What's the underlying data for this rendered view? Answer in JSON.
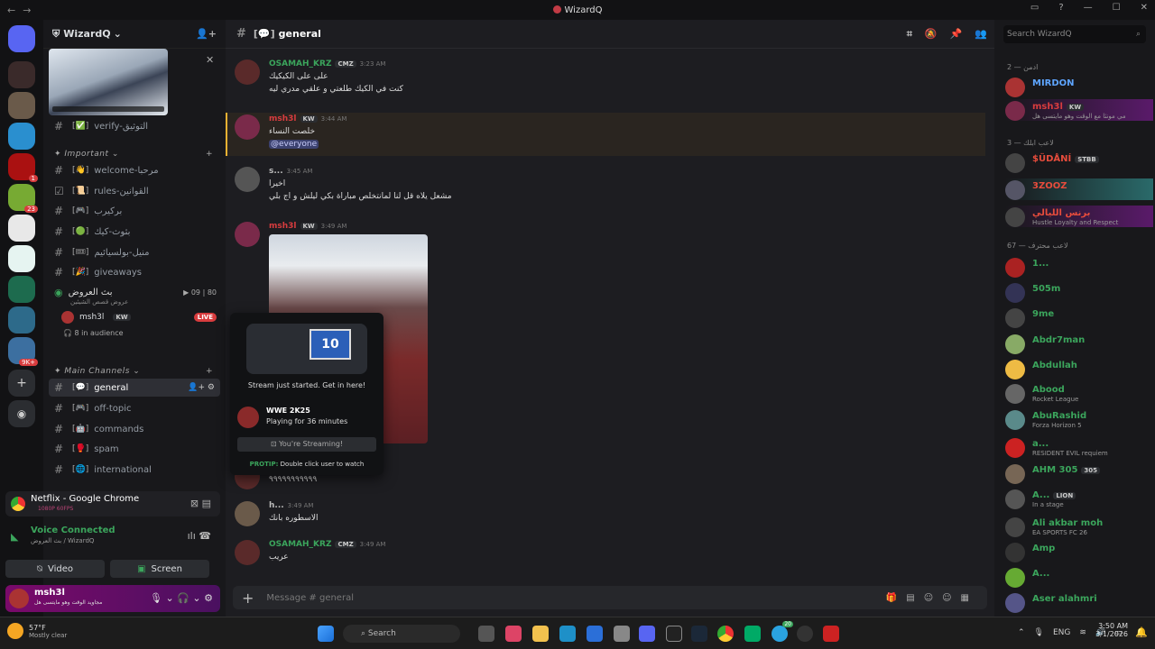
{
  "window": {
    "title": "WizardQ",
    "nav_back": "←",
    "nav_fwd": "→"
  },
  "guild": {
    "name": "WizardQ"
  },
  "channels": [
    {
      "name": "verify-التوثيق",
      "emoji": "✅",
      "kind": "text"
    },
    {
      "category": "Important"
    },
    {
      "name": "welcome-مرحبا",
      "emoji": "👋",
      "kind": "text"
    },
    {
      "name": "rules-القوانين",
      "emoji": "📜",
      "kind": "rules"
    },
    {
      "name": "بركيرب",
      "emoji": "🎮",
      "kind": "text"
    },
    {
      "name": "بثوث-كيك",
      "emoji": "🟢",
      "kind": "text"
    },
    {
      "name": "منيل-بولسيائيم",
      "emoji": "🎟",
      "kind": "text"
    },
    {
      "name": "giveaways",
      "emoji": "🎉",
      "kind": "text"
    },
    {
      "category": "Main Channels"
    },
    {
      "name": "general",
      "emoji": "💬",
      "kind": "text",
      "active": true
    },
    {
      "name": "off-topic",
      "emoji": "🎮",
      "kind": "text"
    },
    {
      "name": "commands",
      "emoji": "🤖",
      "kind": "text"
    },
    {
      "name": "spam",
      "emoji": "🥊",
      "kind": "text"
    },
    {
      "name": "international",
      "emoji": "🌐",
      "kind": "text"
    }
  ],
  "categories": {
    "important": "Important",
    "main": "Main Channels"
  },
  "voice": {
    "channel": "بث العروض",
    "sub": "عروض قصص الشيئين",
    "count1": "09",
    "count2": "80",
    "user": "msh3l",
    "user_tag": "KW",
    "live": "LIVE",
    "audience": "8 in audience"
  },
  "stream_card": {
    "title": "Netflix - Google Chrome",
    "quality": "1080P 60FPS"
  },
  "vc": {
    "status": "Voice Connected",
    "location": "بث العروض / WizardQ",
    "video": "Video",
    "screen": "Screen"
  },
  "me": {
    "name": "msh3l",
    "status": "مجاويد الوقت وهو مايتسى هل"
  },
  "chat": {
    "channel": "general",
    "messages": [
      {
        "author": "OSAMAH_KRZ",
        "tag": "CMZ",
        "time": "3:23 AM",
        "lines": [
          "على على الكيكيك",
          "كنت في الكيك طلعتي و علقي مدري ليه"
        ],
        "color": "#3ba55c"
      },
      {
        "author": "msh3l",
        "tag": "KW",
        "time": "3:44 AM",
        "lines": [
          "خلصت النساء"
        ],
        "mention": "@everyone",
        "color": "#d83c3e"
      },
      {
        "author": "s...",
        "tag": "",
        "time": "3:45 AM",
        "lines": [
          "اخيرا",
          "مشعل يلاه قل لنا لمانتخلص مباراة بكي ليلش و اج بلي"
        ],
        "color": "#bbb"
      },
      {
        "author": "msh3l",
        "tag": "KW",
        "time": "3:49 AM",
        "lines": [],
        "color": "#d83c3e"
      },
      {
        "author": "",
        "tag": "",
        "time": "AM",
        "lines": [
          "٩٩٩٩٩٩٩٩٩٩٩"
        ],
        "color": "#bbb"
      },
      {
        "author": "h...",
        "tag": "",
        "time": "3:49 AM",
        "lines": [
          "الاسطوره بانك"
        ],
        "color": "#bbb"
      },
      {
        "author": "OSAMAH_KRZ",
        "tag": "CMZ",
        "time": "3:49 AM",
        "lines": [
          "عريب"
        ],
        "color": "#3ba55c"
      }
    ],
    "input_placeholder": "Message #  general"
  },
  "popup": {
    "tv_label": "10",
    "caption": "Stream just started. Get in here!",
    "game": "WWE 2K25",
    "playing": "Playing for 36 minutes",
    "btn": "You're Streaming!",
    "protip_label": "PROTIP:",
    "protip": "Double click user to watch"
  },
  "members": {
    "search_placeholder": "Search WizardQ",
    "groups": [
      {
        "label": "ادمن — 2"
      },
      {
        "label": "لاعب ابلك — 3"
      },
      {
        "label": "لاعب محترف — 67"
      }
    ],
    "list": [
      {
        "name": "MIRDON",
        "color": "#5ea5ff",
        "sub": ""
      },
      {
        "name": "msh3l",
        "color": "#d83c3e",
        "sub": "مي مونثا مع الوقت وهو مايتسى هل",
        "tag": "KW"
      },
      {
        "name": "$ÜDÅNÍ",
        "color": "#e74c3c",
        "sub": "",
        "tag": "STBB"
      },
      {
        "name": "3ZOOZ",
        "color": "#e74c3c",
        "sub": ""
      },
      {
        "name": "برنس الليالي",
        "color": "#e74c3c",
        "sub": "Hustle Loyalty and Respect"
      },
      {
        "name": "1...",
        "color": "#3ba55c",
        "sub": ""
      },
      {
        "name": "505m",
        "color": "#3ba55c",
        "sub": ""
      },
      {
        "name": "9me",
        "color": "#3ba55c",
        "sub": ""
      },
      {
        "name": "Abdr7man",
        "color": "#3ba55c",
        "sub": ""
      },
      {
        "name": "Abdullah",
        "color": "#3ba55c",
        "sub": ""
      },
      {
        "name": "Abood",
        "color": "#3ba55c",
        "sub": "Rocket League"
      },
      {
        "name": "AbuRashid",
        "color": "#3ba55c",
        "sub": "Forza Horizon 5"
      },
      {
        "name": "a...",
        "color": "#3ba55c",
        "sub": "RESIDENT EVIL requiem"
      },
      {
        "name": "AHM 305",
        "color": "#3ba55c",
        "sub": "",
        "tag": "305"
      },
      {
        "name": "A...",
        "color": "#3ba55c",
        "sub": "In a stage",
        "tag": "LION"
      },
      {
        "name": "Ali akbar moh",
        "color": "#3ba55c",
        "sub": "EA SPORTS FC 26"
      },
      {
        "name": "Amp",
        "color": "#3ba55c",
        "sub": ""
      },
      {
        "name": "A...",
        "color": "#3ba55c",
        "sub": ""
      },
      {
        "name": "Aser alahmri",
        "color": "#3ba55c",
        "sub": ""
      }
    ]
  },
  "taskbar": {
    "weather_temp": "57°F",
    "weather_text": "Mostly clear",
    "search": "Search",
    "lang": "ENG",
    "time": "3:50 AM",
    "date": "3/1/2026",
    "badge_count": "20"
  },
  "servers": [
    {
      "badge": ""
    },
    {
      "badge": ""
    },
    {
      "badge": ""
    },
    {
      "badge": "1"
    },
    {
      "badge": "23"
    },
    {
      "badge": ""
    },
    {
      "badge": ""
    },
    {
      "badge": ""
    },
    {
      "badge": ""
    },
    {
      "badge": "9K+"
    }
  ]
}
